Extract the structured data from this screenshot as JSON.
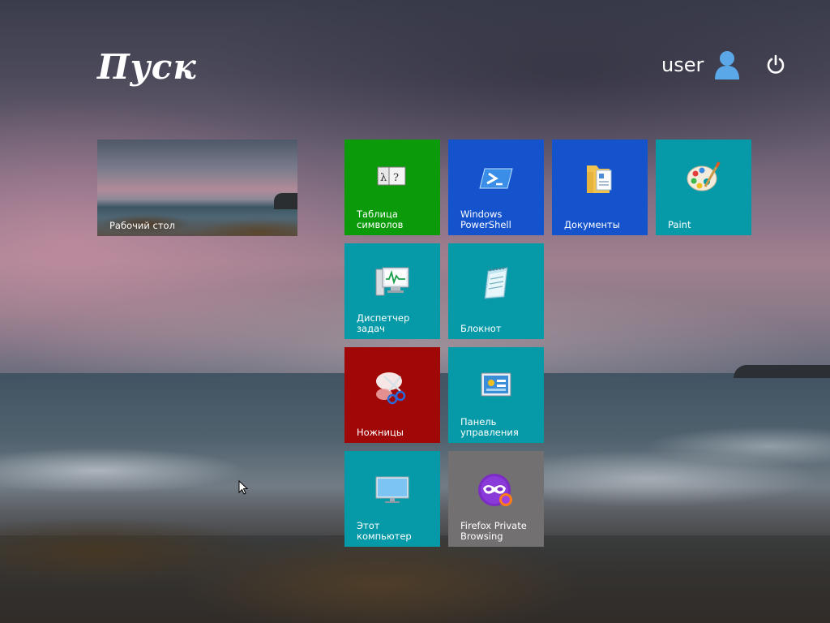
{
  "header": {
    "title": "Пуск",
    "user_name": "user",
    "user_icon": "user-icon",
    "power_icon": "power-icon"
  },
  "desktop_tile": {
    "label": "Рабочий стол"
  },
  "tiles": [
    {
      "label": "Таблица\nсимволов",
      "icon": "character-map-icon",
      "color": "#0a9a0a"
    },
    {
      "label": "Windows\nPowerShell",
      "icon": "powershell-icon",
      "color": "#1553cc"
    },
    {
      "label": "Документы",
      "icon": "documents-folder-icon",
      "color": "#1553cc"
    },
    {
      "label": "Paint",
      "icon": "paint-palette-icon",
      "color": "#069aa8"
    },
    {
      "label": "Диспетчер\nзадач",
      "icon": "task-manager-icon",
      "color": "#069aa8"
    },
    {
      "label": "Блокнот",
      "icon": "notepad-icon",
      "color": "#069aa8"
    },
    {
      "label": "Ножницы",
      "icon": "scissors-icon",
      "color": "#a00808"
    },
    {
      "label": "Панель\nуправления",
      "icon": "control-panel-icon",
      "color": "#069aa8"
    },
    {
      "label": "Этот компьютер",
      "icon": "computer-monitor-icon",
      "color": "#069aa8"
    },
    {
      "label": "Firefox Private\nBrowsing",
      "icon": "firefox-private-icon",
      "color": "#727070"
    }
  ]
}
